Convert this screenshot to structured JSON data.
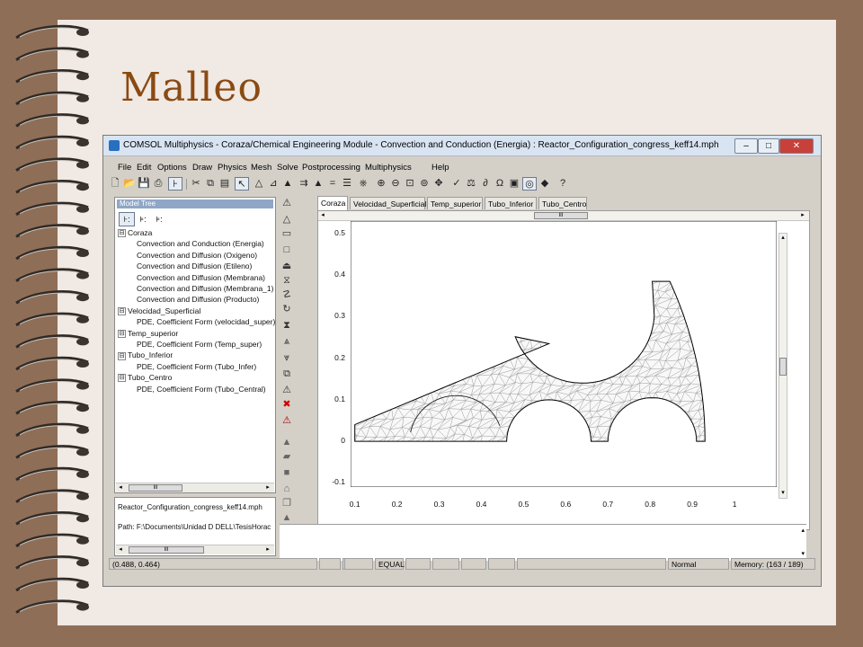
{
  "slide": {
    "title": "Malleo"
  },
  "window": {
    "title": "COMSOL Multiphysics - Coraza/Chemical Engineering Module - Convection and Conduction (Energia) : Reactor_Configuration_congress_keff14.mph",
    "controls": {
      "minimize": "–",
      "maximize": "□",
      "close": "✕"
    }
  },
  "menu": [
    "File",
    "Edit",
    "Options",
    "Draw",
    "Physics",
    "Mesh",
    "Solve",
    "Postprocessing",
    "Multiphysics",
    "Help"
  ],
  "model_tree": {
    "header": "Model Tree",
    "view_buttons": [
      "⊦:",
      "⊧:",
      "⊧:"
    ],
    "items": [
      {
        "label": "Coraza",
        "level": 0,
        "toggle": "⊟"
      },
      {
        "label": "Convection and Conduction (Energia)",
        "level": 1
      },
      {
        "label": "Convection and Diffusion (Oxigeno)",
        "level": 1
      },
      {
        "label": "Convection and Diffusion (Etileno)",
        "level": 1
      },
      {
        "label": "Convection and Diffusion (Membrana)",
        "level": 1
      },
      {
        "label": "Convection and Diffusion (Membrana_1)",
        "level": 1
      },
      {
        "label": "Convection and Diffusion (Producto)",
        "level": 1
      },
      {
        "label": "Velocidad_Superficial",
        "level": 0,
        "toggle": "⊟"
      },
      {
        "label": "PDE, Coefficient Form (velocidad_super)",
        "level": 1
      },
      {
        "label": "Temp_superior",
        "level": 0,
        "toggle": "⊟"
      },
      {
        "label": "PDE, Coefficient Form (Temp_super)",
        "level": 1
      },
      {
        "label": "Tubo_Inferior",
        "level": 0,
        "toggle": "⊟"
      },
      {
        "label": "PDE, Coefficient Form (Tubo_Infer)",
        "level": 1
      },
      {
        "label": "Tubo_Centro",
        "level": 0,
        "toggle": "⊟"
      },
      {
        "label": "PDE, Coefficient Form (Tubo_Central)",
        "level": 1
      }
    ],
    "scroll_thumb": "III"
  },
  "file_info": {
    "filename": "Reactor_Configuration_congress_keff14.mph",
    "path": "Path: F:\\Documents\\Unidad D DELL\\TesisHorac"
  },
  "tabs": [
    {
      "label": "Coraza",
      "active": true
    },
    {
      "label": "Velocidad_Superficial",
      "active": false
    },
    {
      "label": "Temp_superior",
      "active": false
    },
    {
      "label": "Tubo_Inferior",
      "active": false
    },
    {
      "label": "Tubo_Centro",
      "active": false
    }
  ],
  "plot": {
    "xticks": [
      "0.1",
      "0.2",
      "0.3",
      "0.4",
      "0.5",
      "0.6",
      "0.7",
      "0.8",
      "0.9",
      "1"
    ],
    "yticks": [
      "0.5",
      "0.4",
      "0.3",
      "0.2",
      "0.1",
      "0",
      "-0.1"
    ],
    "xlim": [
      0.09,
      1.1
    ],
    "ylim": [
      -0.11,
      0.53
    ],
    "mesh_color": "#9a9a9a",
    "boundary_color": "#000000",
    "scroll_thumb": "III"
  },
  "status": {
    "coords": "(0.488, 0.464)",
    "mode": "EQUAL",
    "state": "Normal",
    "memory": "Memory: (163 / 189)"
  },
  "icons": {
    "toolbar": [
      "new-file-icon",
      "open-folder-icon",
      "save-icon",
      "print-icon",
      "model-tree-icon",
      "cut-icon",
      "copy-icon",
      "paste-icon",
      "pointer-icon",
      "draw-mode-icon",
      "point-mode-icon",
      "boundary-mode-icon",
      "subdomain-mode-icon",
      "mesh-mode-icon",
      "solve-mode-icon",
      "post-mode-icon",
      "zoom-in-icon",
      "zoom-out-icon",
      "zoom-window-icon",
      "zoom-extents-icon",
      "move-icon",
      "refine-icon",
      "solver-icon",
      "plot-icon",
      "omega-icon",
      "subdomain-settings-icon",
      "help-icon"
    ]
  }
}
